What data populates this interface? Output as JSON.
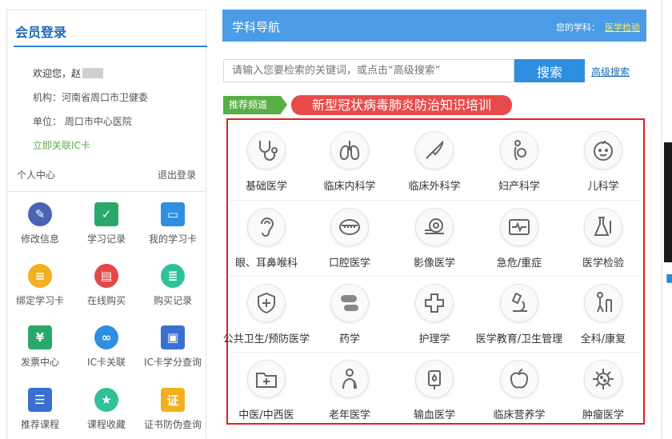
{
  "login": {
    "title": "会员登录",
    "welcome": "欢迎您，赵",
    "org": "机构：河南省周口市卫健委",
    "unit": "单位：  周口市中心医院",
    "link_ic": "立即关联IC卡",
    "personal_center": "个人中心",
    "logout": "退出登录"
  },
  "functions": [
    {
      "label": "修改信息",
      "icon": "edit-icon",
      "glyph": "✎",
      "color": "#4a64b5"
    },
    {
      "label": "学习记录",
      "icon": "bookmark-icon",
      "glyph": "✓",
      "color": "#2aa86a"
    },
    {
      "label": "我的学习卡",
      "icon": "card-hand-icon",
      "glyph": "▭",
      "color": "#2e8ee0"
    },
    {
      "label": "绑定学习卡",
      "icon": "bind-card-icon",
      "glyph": "≡",
      "color": "#f2b01e"
    },
    {
      "label": "在线购买",
      "icon": "cart-icon",
      "glyph": "▤",
      "color": "#e44848"
    },
    {
      "label": "购买记录",
      "icon": "list-icon",
      "glyph": "≣",
      "color": "#2fc29a"
    },
    {
      "label": "发票中心",
      "icon": "invoice-icon",
      "glyph": "¥",
      "color": "#2aa86a"
    },
    {
      "label": "IC卡关联",
      "icon": "link-icon",
      "glyph": "∞",
      "color": "#2e8ee0"
    },
    {
      "label": "IC卡学分查询",
      "icon": "monitor-search-icon",
      "glyph": "▣",
      "color": "#3a6fd0"
    },
    {
      "label": "推荐课程",
      "icon": "books-icon",
      "glyph": "☰",
      "color": "#3a6fd0"
    },
    {
      "label": "课程收藏",
      "icon": "star-icon",
      "glyph": "★",
      "color": "#2fc29a"
    },
    {
      "label": "证书防伪查询",
      "icon": "certificate-icon",
      "glyph": "证",
      "color": "#f2b01e"
    }
  ],
  "nav": {
    "title": "学科导航",
    "subject_label": "您的学科：",
    "subject_value": "医学检验"
  },
  "search": {
    "placeholder": "请输入您要检索的关键词，或点击“高级搜索”",
    "button": "搜索",
    "advanced": "高级搜索"
  },
  "recommend": {
    "tag": "推荐频道",
    "promo": "新型冠状病毒肺炎防治知识培训"
  },
  "subjects": [
    {
      "label": "基础医学",
      "icon": "stethoscope-icon"
    },
    {
      "label": "临床内科学",
      "icon": "lungs-icon"
    },
    {
      "label": "临床外科学",
      "icon": "scalpel-icon"
    },
    {
      "label": "妇产科学",
      "icon": "pregnancy-icon"
    },
    {
      "label": "儿科学",
      "icon": "baby-face-icon"
    },
    {
      "label": "眼、耳鼻喉科",
      "icon": "ear-icon"
    },
    {
      "label": "口腔医学",
      "icon": "mouth-icon"
    },
    {
      "label": "影像医学",
      "icon": "ct-scanner-icon"
    },
    {
      "label": "急危/重症",
      "icon": "heart-monitor-icon"
    },
    {
      "label": "医学检验",
      "icon": "lab-flask-icon"
    },
    {
      "label": "公共卫生/预防医学",
      "icon": "shield-cross-icon"
    },
    {
      "label": "药学",
      "icon": "pill-icon"
    },
    {
      "label": "护理学",
      "icon": "nurse-cross-icon"
    },
    {
      "label": "医学教育/卫生管理",
      "icon": "microscope-icon"
    },
    {
      "label": "全科/康复",
      "icon": "walker-icon"
    },
    {
      "label": "中医/中西医",
      "icon": "medical-folder-icon"
    },
    {
      "label": "老年医学",
      "icon": "elderly-icon"
    },
    {
      "label": "输血医学",
      "icon": "blood-bag-icon"
    },
    {
      "label": "临床营养学",
      "icon": "apple-icon"
    },
    {
      "label": "肿瘤医学",
      "icon": "virus-icon"
    }
  ],
  "colors": {
    "accent_blue": "#4b9be5",
    "button_blue": "#2e8ee0",
    "green": "#58b045",
    "promo_red": "#e84a4a",
    "frame_red": "#e02020"
  }
}
